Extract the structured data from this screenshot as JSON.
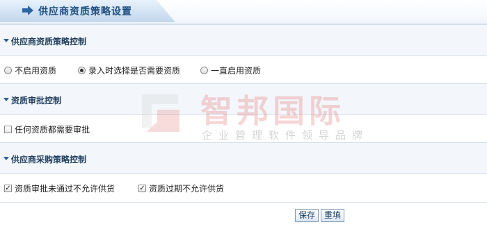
{
  "page_title": "供应商资质策略设置",
  "sections": [
    {
      "title": "供应商资质策略控制"
    },
    {
      "title": "资质审批控制"
    },
    {
      "title": "供应商采购策略控制"
    }
  ],
  "qualification_strategy": {
    "options": [
      {
        "label": "不启用资质",
        "selected": false
      },
      {
        "label": "录入时选择是否需要资质",
        "selected": true
      },
      {
        "label": "一直启用资质",
        "selected": false
      }
    ]
  },
  "approval": {
    "all_need_approval": {
      "label": "任何资质都需要审批",
      "checked": false
    }
  },
  "purchase": {
    "reject_unapproved": {
      "label": "资质审批未通过不允许供货",
      "checked": true
    },
    "reject_expired": {
      "label": "资质过期不允许供货",
      "checked": true
    }
  },
  "buttons": {
    "save": "保存",
    "reset": "重填"
  },
  "watermark": {
    "name": "智邦国际",
    "tagline": "企业管理软件领导品牌"
  },
  "colors": {
    "accent": "#1f4f80",
    "watermark": "#e46a6a"
  },
  "icons": {
    "title": "arrow-right-icon",
    "section": "caret-down-icon",
    "logo": "zhibang-logo-icon"
  }
}
